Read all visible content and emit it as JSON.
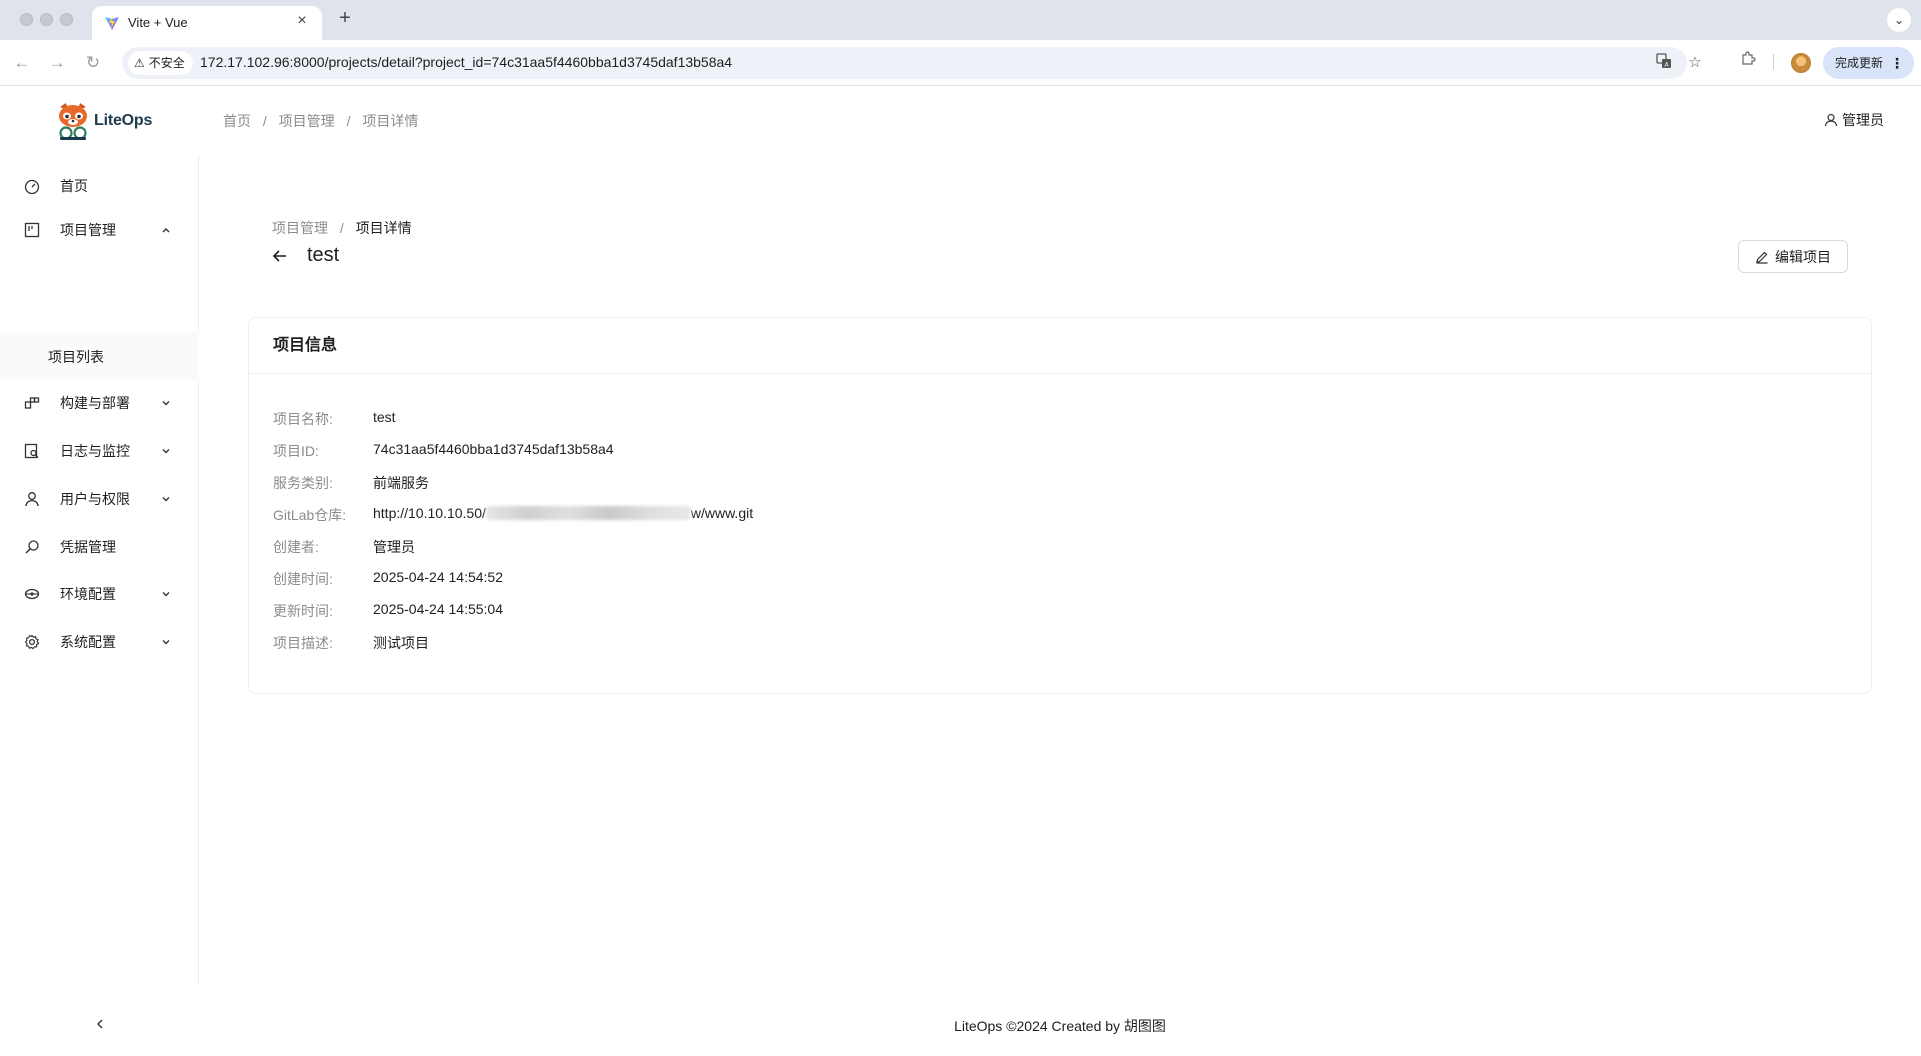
{
  "browser": {
    "tab_title": "Vite + Vue",
    "new_tab": "+",
    "insecure_label": "不安全",
    "url": "172.17.102.96:8000/projects/detail?project_id=74c31aa5f4460bba1d3745daf13b58a4",
    "update_label": "完成更新"
  },
  "app": {
    "logo_text": "LiteOps",
    "header_breadcrumb": [
      "首页",
      "项目管理",
      "项目详情"
    ],
    "user_name": "管理员"
  },
  "sidebar": {
    "items": [
      {
        "label": "首页",
        "icon": "dashboard-icon"
      },
      {
        "label": "项目管理",
        "icon": "project-icon",
        "expanded": true
      },
      {
        "label": "项目列表",
        "submenu": true
      },
      {
        "label": "构建与部署",
        "icon": "build-icon"
      },
      {
        "label": "日志与监控",
        "icon": "log-monitor-icon"
      },
      {
        "label": "用户与权限",
        "icon": "user-icon"
      },
      {
        "label": "凭据管理",
        "icon": "credential-icon"
      },
      {
        "label": "环境配置",
        "icon": "environment-icon"
      },
      {
        "label": "系统配置",
        "icon": "settings-icon"
      }
    ],
    "collapse_icon": "chevron-left-icon"
  },
  "content": {
    "breadcrumb": [
      "项目管理",
      "项目详情"
    ],
    "title": "test",
    "edit_button": "编辑项目",
    "card_title": "项目信息",
    "fields": [
      {
        "label": "项目名称:",
        "value": "test"
      },
      {
        "label": "项目ID:",
        "value": "74c31aa5f4460bba1d3745daf13b58a4"
      },
      {
        "label": "服务类别:",
        "value": "前端服务"
      },
      {
        "label": "GitLab仓库:",
        "value_prefix": "http://10.10.10.50/",
        "value_suffix": "w/www.git"
      },
      {
        "label": "创建者:",
        "value": "管理员"
      },
      {
        "label": "创建时间:",
        "value": "2025-04-24 14:54:52"
      },
      {
        "label": "更新时间:",
        "value": "2025-04-24 14:55:04"
      },
      {
        "label": "项目描述:",
        "value": "测试项目"
      }
    ]
  },
  "footer": {
    "text": "LiteOps ©2024 Created by 胡图图"
  },
  "colors": {
    "tabstrip": "#dfe3eb",
    "omnibox": "#eef1f7",
    "update_button": "#d9e4fb",
    "muted_text": "#8c8c8c",
    "border": "#efefef"
  }
}
